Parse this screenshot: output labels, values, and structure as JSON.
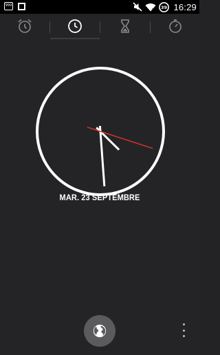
{
  "status_bar": {
    "time": "16:29",
    "battery_level": "39",
    "left_icons": [
      "notification-999-icon",
      "square-icon"
    ],
    "right_icons": [
      "mute-icon",
      "wifi-icon",
      "battery-icon"
    ]
  },
  "tabs": [
    {
      "name": "alarm",
      "icon": "alarm-clock-icon",
      "selected": false
    },
    {
      "name": "clock",
      "icon": "clock-icon",
      "selected": true
    },
    {
      "name": "timer",
      "icon": "hourglass-icon",
      "selected": false
    },
    {
      "name": "stopwatch",
      "icon": "stopwatch-icon",
      "selected": false
    }
  ],
  "clock": {
    "hour": 16,
    "minute": 29,
    "second": 18,
    "face_color": "#ffffff",
    "second_hand_color": "#d9322e"
  },
  "date_label": "MAR. 23 SEPTEMBRE",
  "fab": {
    "icon": "globe-icon"
  },
  "overflow": {
    "icon": "more-vert-icon"
  },
  "colors": {
    "background": "#242426",
    "status_bar": "#000000",
    "fab": "#5b5b5e",
    "tab_icon": "#8a8a8d",
    "tab_icon_selected": "#ffffff"
  }
}
